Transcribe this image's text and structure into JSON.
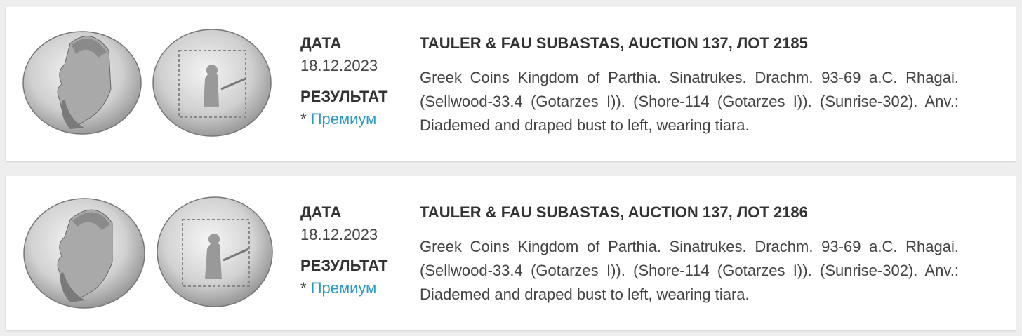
{
  "lots": [
    {
      "date_label": "ДАТА",
      "date_value": "18.12.2023",
      "result_label": "РЕЗУЛЬТАТ",
      "result_prefix": "*",
      "result_link": "Премиум",
      "title": "TAULER & FAU SUBASTAS, AUCTION 137, ЛОТ 2185",
      "description": "Greek Coins Kingdom of Parthia. Sinatrukes. Drachm. 93-69 a.C. Rhagai. (Sellwood-33.4 (Gotarzes I)). (Shore-114 (Gotarzes I)). (Sunrise-302). Anv.: Diademed and draped bust to left, wearing tiara.",
      "images": {
        "obverse": "coin-obverse-image",
        "reverse": "coin-reverse-image"
      }
    },
    {
      "date_label": "ДАТА",
      "date_value": "18.12.2023",
      "result_label": "РЕЗУЛЬТАТ",
      "result_prefix": "*",
      "result_link": "Премиум",
      "title": "TAULER & FAU SUBASTAS, AUCTION 137, ЛОТ 2186",
      "description": "Greek Coins Kingdom of Parthia. Sinatrukes. Drachm. 93-69 a.C. Rhagai. (Sellwood-33.4 (Gotarzes I)). (Shore-114 (Gotarzes I)). (Sunrise-302). Anv.: Diademed and draped bust to left, wearing tiara.",
      "images": {
        "obverse": "coin-obverse-image",
        "reverse": "coin-reverse-image"
      }
    }
  ],
  "colors": {
    "page_bg": "#eeeeee",
    "card_bg": "#ffffff",
    "heading": "#333333",
    "text": "#444444",
    "link": "#2a9bc6"
  }
}
